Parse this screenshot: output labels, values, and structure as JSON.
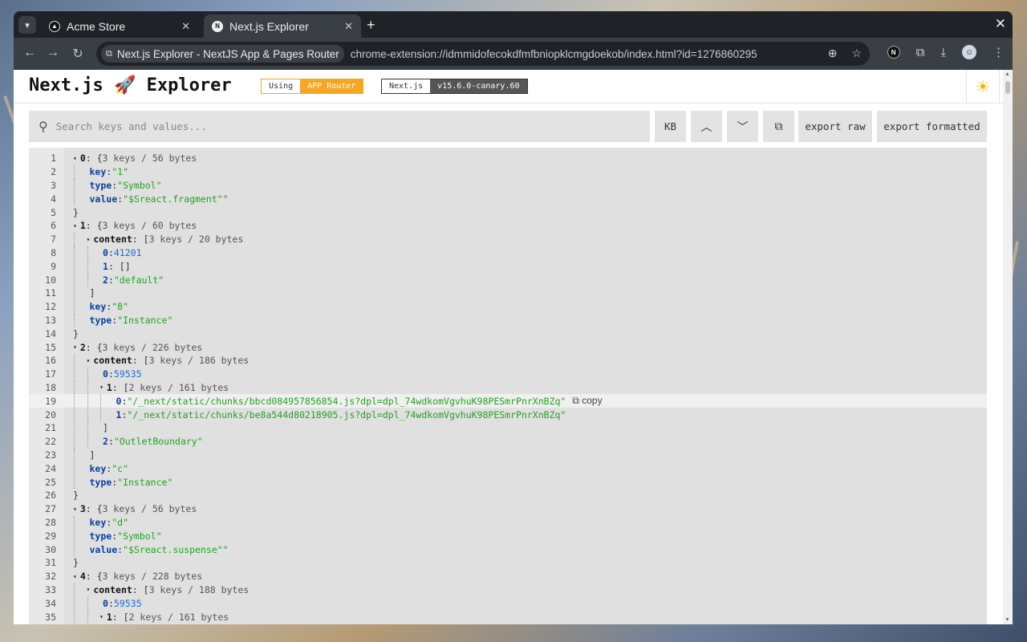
{
  "browser": {
    "tabs": [
      {
        "title": "Acme Store",
        "active": false
      },
      {
        "title": "Next.js Explorer",
        "active": true
      }
    ],
    "site_chip": "Next.js Explorer - NextJS App & Pages Router",
    "url": "chrome-extension://idmmidofecokdfmfbniopklcmgdoekob/index.html?id=1276860295"
  },
  "header": {
    "logo": "Next.js 🚀 Explorer",
    "router_badge": {
      "label": "Using",
      "value": "APP Router"
    },
    "version_badge": {
      "label": "Next.js",
      "value": "v15.6.0-canary.60"
    }
  },
  "search": {
    "placeholder": "Search keys and values...",
    "buttons": {
      "kb": "KB",
      "export_raw": "export raw",
      "export_formatted": "export formatted"
    }
  },
  "copy_label": "copy",
  "tree_lines": [
    {
      "n": "1",
      "ind": 0,
      "parts": [
        [
          "tw",
          "▾"
        ],
        [
          "kbold",
          "0"
        ],
        [
          "p",
          ": { "
        ],
        [
          "meta",
          "3 keys / 56 bytes"
        ]
      ]
    },
    {
      "n": "2",
      "ind": 1,
      "parts": [
        [
          "k",
          "key"
        ],
        [
          "p",
          ": "
        ],
        [
          "str",
          "\"1\""
        ]
      ]
    },
    {
      "n": "3",
      "ind": 1,
      "parts": [
        [
          "k",
          "type"
        ],
        [
          "p",
          ": "
        ],
        [
          "str",
          "\"Symbol\""
        ]
      ]
    },
    {
      "n": "4",
      "ind": 1,
      "parts": [
        [
          "k",
          "value"
        ],
        [
          "p",
          ": "
        ],
        [
          "str",
          "\"$Sreact.fragment\"\""
        ]
      ]
    },
    {
      "n": "5",
      "ind": 0,
      "parts": [
        [
          "p",
          "}"
        ]
      ]
    },
    {
      "n": "6",
      "ind": 0,
      "parts": [
        [
          "tw",
          "▾"
        ],
        [
          "kbold",
          "1"
        ],
        [
          "p",
          ": { "
        ],
        [
          "meta",
          "3 keys / 60 bytes"
        ]
      ]
    },
    {
      "n": "7",
      "ind": 1,
      "parts": [
        [
          "tw",
          "▾"
        ],
        [
          "kbold",
          "content"
        ],
        [
          "p",
          ": [ "
        ],
        [
          "meta",
          "3 keys / 20 bytes"
        ]
      ]
    },
    {
      "n": "8",
      "ind": 2,
      "parts": [
        [
          "k",
          "0"
        ],
        [
          "p",
          ": "
        ],
        [
          "num",
          "41201"
        ]
      ]
    },
    {
      "n": "9",
      "ind": 2,
      "parts": [
        [
          "k",
          "1"
        ],
        [
          "p",
          ": []"
        ]
      ]
    },
    {
      "n": "10",
      "ind": 2,
      "parts": [
        [
          "k",
          "2"
        ],
        [
          "p",
          ": "
        ],
        [
          "str",
          "\"default\""
        ]
      ]
    },
    {
      "n": "11",
      "ind": 1,
      "parts": [
        [
          "p",
          "]"
        ]
      ]
    },
    {
      "n": "12",
      "ind": 1,
      "parts": [
        [
          "k",
          "key"
        ],
        [
          "p",
          ": "
        ],
        [
          "str",
          "\"8\""
        ]
      ]
    },
    {
      "n": "13",
      "ind": 1,
      "parts": [
        [
          "k",
          "type"
        ],
        [
          "p",
          ": "
        ],
        [
          "str",
          "\"Instance\""
        ]
      ]
    },
    {
      "n": "14",
      "ind": 0,
      "parts": [
        [
          "p",
          "}"
        ]
      ]
    },
    {
      "n": "15",
      "ind": 0,
      "parts": [
        [
          "tw",
          "▾"
        ],
        [
          "kbold",
          "2"
        ],
        [
          "p",
          ": { "
        ],
        [
          "meta",
          "3 keys / 226 bytes"
        ]
      ]
    },
    {
      "n": "16",
      "ind": 1,
      "parts": [
        [
          "tw",
          "▾"
        ],
        [
          "kbold",
          "content"
        ],
        [
          "p",
          ": [ "
        ],
        [
          "meta",
          "3 keys / 186 bytes"
        ]
      ]
    },
    {
      "n": "17",
      "ind": 2,
      "parts": [
        [
          "k",
          "0"
        ],
        [
          "p",
          ": "
        ],
        [
          "num",
          "59535"
        ]
      ]
    },
    {
      "n": "18",
      "ind": 2,
      "parts": [
        [
          "tw",
          "▾"
        ],
        [
          "kbold",
          "1"
        ],
        [
          "p",
          ": [ "
        ],
        [
          "meta",
          "2 keys / 161 bytes"
        ]
      ]
    },
    {
      "n": "19",
      "ind": 3,
      "hl": true,
      "parts": [
        [
          "k",
          "0"
        ],
        [
          "p",
          ": "
        ],
        [
          "str",
          "\"/_next/static/chunks/bbcd084957856854.js?dpl=dpl_74wdkomVgvhuK98PESmrPnrXnBZq\""
        ]
      ]
    },
    {
      "n": "20",
      "ind": 3,
      "parts": [
        [
          "k",
          "1"
        ],
        [
          "p",
          ": "
        ],
        [
          "str",
          "\"/_next/static/chunks/be8a544d80218905.js?dpl=dpl_74wdkomVgvhuK98PESmrPnrXnBZq\""
        ]
      ]
    },
    {
      "n": "21",
      "ind": 2,
      "parts": [
        [
          "p",
          "]"
        ]
      ]
    },
    {
      "n": "22",
      "ind": 2,
      "parts": [
        [
          "k",
          "2"
        ],
        [
          "p",
          ": "
        ],
        [
          "str",
          "\"OutletBoundary\""
        ]
      ]
    },
    {
      "n": "23",
      "ind": 1,
      "parts": [
        [
          "p",
          "]"
        ]
      ]
    },
    {
      "n": "24",
      "ind": 1,
      "parts": [
        [
          "k",
          "key"
        ],
        [
          "p",
          ": "
        ],
        [
          "str",
          "\"c\""
        ]
      ]
    },
    {
      "n": "25",
      "ind": 1,
      "parts": [
        [
          "k",
          "type"
        ],
        [
          "p",
          ": "
        ],
        [
          "str",
          "\"Instance\""
        ]
      ]
    },
    {
      "n": "26",
      "ind": 0,
      "parts": [
        [
          "p",
          "}"
        ]
      ]
    },
    {
      "n": "27",
      "ind": 0,
      "parts": [
        [
          "tw",
          "▾"
        ],
        [
          "kbold",
          "3"
        ],
        [
          "p",
          ": { "
        ],
        [
          "meta",
          "3 keys / 56 bytes"
        ]
      ]
    },
    {
      "n": "28",
      "ind": 1,
      "parts": [
        [
          "k",
          "key"
        ],
        [
          "p",
          ": "
        ],
        [
          "str",
          "\"d\""
        ]
      ]
    },
    {
      "n": "29",
      "ind": 1,
      "parts": [
        [
          "k",
          "type"
        ],
        [
          "p",
          ": "
        ],
        [
          "str",
          "\"Symbol\""
        ]
      ]
    },
    {
      "n": "30",
      "ind": 1,
      "parts": [
        [
          "k",
          "value"
        ],
        [
          "p",
          ": "
        ],
        [
          "str",
          "\"$Sreact.suspense\"\""
        ]
      ]
    },
    {
      "n": "31",
      "ind": 0,
      "parts": [
        [
          "p",
          "}"
        ]
      ]
    },
    {
      "n": "32",
      "ind": 0,
      "parts": [
        [
          "tw",
          "▾"
        ],
        [
          "kbold",
          "4"
        ],
        [
          "p",
          ": { "
        ],
        [
          "meta",
          "3 keys / 228 bytes"
        ]
      ]
    },
    {
      "n": "33",
      "ind": 1,
      "parts": [
        [
          "tw",
          "▾"
        ],
        [
          "kbold",
          "content"
        ],
        [
          "p",
          ": [ "
        ],
        [
          "meta",
          "3 keys / 188 bytes"
        ]
      ]
    },
    {
      "n": "34",
      "ind": 2,
      "parts": [
        [
          "k",
          "0"
        ],
        [
          "p",
          ": "
        ],
        [
          "num",
          "59535"
        ]
      ]
    },
    {
      "n": "35",
      "ind": 2,
      "parts": [
        [
          "tw",
          "▾"
        ],
        [
          "kbold",
          "1"
        ],
        [
          "p",
          ": [ "
        ],
        [
          "meta",
          "2 keys / 161 bytes"
        ]
      ]
    }
  ]
}
